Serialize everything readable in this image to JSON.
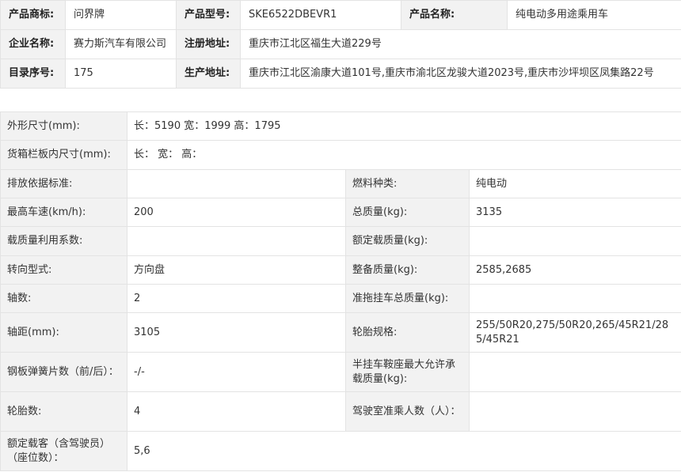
{
  "top": {
    "brand_label": "产品商标:",
    "brand_value": "问界牌",
    "model_label": "产品型号:",
    "model_value": "SKE6522DBEVR1",
    "name_label": "产品名称:",
    "name_value": "纯电动多用途乘用车",
    "company_label": "企业名称:",
    "company_value": "赛力斯汽车有限公司",
    "reg_addr_label": "注册地址:",
    "reg_addr_value": "重庆市江北区福生大道229号",
    "catalog_label": "目录序号:",
    "catalog_value": "175",
    "prod_addr_label": "生产地址:",
    "prod_addr_value": "重庆市江北区渝康大道101号,重庆市渝北区龙骏大道2023号,重庆市沙坪坝区凤集路22号"
  },
  "spec": {
    "dims_label": "外形尺寸(mm):",
    "dims_value": "长：5190 宽：1999 高：1795",
    "cargo_label": "货箱栏板内尺寸(mm):",
    "cargo_value": "长：  宽：  高：",
    "emission_label": "排放依据标准:",
    "emission_value": "",
    "fuel_label": "燃料种类:",
    "fuel_value": "纯电动",
    "speed_label": "最高车速(km/h):",
    "speed_value": "200",
    "total_mass_label": "总质量(kg):",
    "total_mass_value": "3135",
    "load_factor_label": "载质量利用系数:",
    "load_factor_value": "",
    "rated_load_label": "额定载质量(kg):",
    "rated_load_value": "",
    "steering_label": "转向型式:",
    "steering_value": "方向盘",
    "curb_label": "整备质量(kg):",
    "curb_value": "2585,2685",
    "axles_label": "轴数:",
    "axles_value": "2",
    "trailer_label": "准拖挂车总质量(kg):",
    "trailer_value": "",
    "wheelbase_label": "轴距(mm):",
    "wheelbase_value": "3105",
    "tire_spec_label": "轮胎规格:",
    "tire_spec_value": "255/50R20,275/50R20,265/45R21/285/45R21",
    "spring_label": "钢板弹簧片数（前/后）：",
    "spring_value": "-/-",
    "saddle_label": "半挂车鞍座最大允许承载质量(kg):",
    "saddle_value": "",
    "tires_label": "轮胎数:",
    "tires_value": "4",
    "cab_label": "驾驶室准乘人数（人）：",
    "cab_value": "",
    "seats_label": "额定载客（含驾驶员）（座位数）：",
    "seats_value": "5,6"
  }
}
